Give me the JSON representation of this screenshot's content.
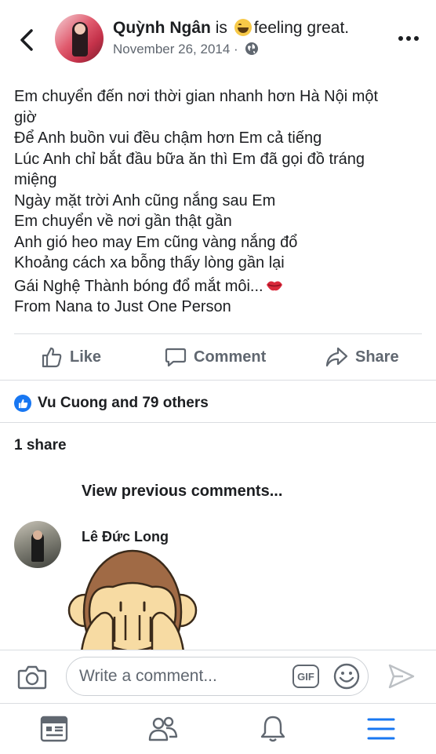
{
  "header": {
    "author": "Quỳnh Ngân",
    "is_text": "is",
    "feeling": "feeling great.",
    "date": "November 26, 2014 ·"
  },
  "post": {
    "lines": [
      "Em chuyển đến nơi thời gian nhanh hơn Hà Nội một",
      "giờ",
      "Để Anh buồn vui đều chậm hơn Em cả tiếng",
      "Lúc Anh chỉ bắt đầu bữa ăn thì Em đã gọi đồ tráng",
      "miệng",
      "Ngày mặt trời Anh cũng nắng sau Em",
      "Em chuyển về nơi gần thật gần",
      "Anh gió heo may Em cũng vàng nắng đổ",
      "Khoảng cách xa bỗng thấy lòng gần lại",
      "Gái Nghệ Thành bóng đổ mắt môi...",
      "From Nana to Just One Person"
    ]
  },
  "actions": {
    "like": "Like",
    "comment": "Comment",
    "share": "Share"
  },
  "reactions": {
    "text": "Vu Cuong and 79 others"
  },
  "shares": {
    "text": "1 share"
  },
  "comments": {
    "view_previous": "View previous comments...",
    "author": "Lê Đức Long"
  },
  "composer": {
    "placeholder": "Write a comment...",
    "gif": "GIF"
  },
  "colors": {
    "accent": "#1877f2",
    "text": "#1c1e21",
    "muted": "#606770"
  }
}
